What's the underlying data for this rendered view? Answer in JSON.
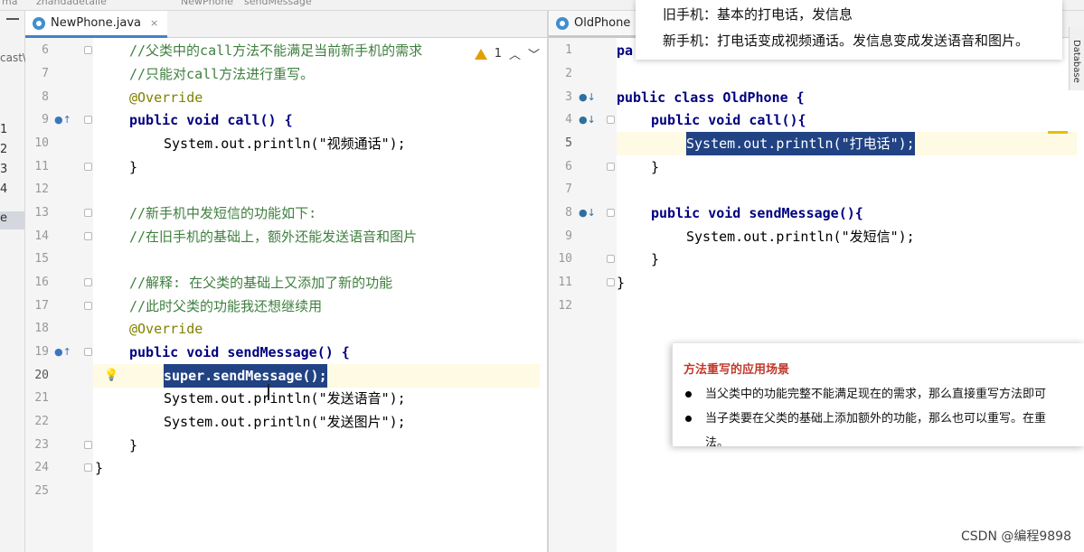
{
  "breadcrumb": {
    "part1": "ma",
    "part2": "zhandadetaile",
    "part3": "NewPhone",
    "part4": "sendMessage"
  },
  "project": {
    "cast_label": "cast\\",
    "numbers": [
      "1",
      "2",
      "3",
      "4"
    ],
    "selected": "e"
  },
  "left_editor": {
    "tab_label": "NewPhone.java",
    "tab_close": "×",
    "warning_count": "1",
    "lines": [
      {
        "n": "6",
        "text": "//父类中的call方法不能满足当前新手机的需求"
      },
      {
        "n": "7",
        "text": "//只能对call方法进行重写。"
      },
      {
        "n": "8",
        "text": "@Override"
      },
      {
        "n": "9",
        "text": "public void call() {"
      },
      {
        "n": "10",
        "text": "System.out.println(\"视频通话\");"
      },
      {
        "n": "11",
        "text": "}"
      },
      {
        "n": "12",
        "text": ""
      },
      {
        "n": "13",
        "text": "//新手机中发短信的功能如下:"
      },
      {
        "n": "14",
        "text": "//在旧手机的基础上，额外还能发送语音和图片"
      },
      {
        "n": "15",
        "text": ""
      },
      {
        "n": "16",
        "text": "//解释: 在父类的基础上又添加了新的功能"
      },
      {
        "n": "17",
        "text": "//此时父类的功能我还想继续用"
      },
      {
        "n": "18",
        "text": "@Override"
      },
      {
        "n": "19",
        "text": "public void sendMessage() {"
      },
      {
        "n": "20",
        "text": "super.sendMessage();"
      },
      {
        "n": "21",
        "text": "System.out.println(\"发送语音\");"
      },
      {
        "n": "22",
        "text": "System.out.println(\"发送图片\");"
      },
      {
        "n": "23",
        "text": "}"
      },
      {
        "n": "24",
        "text": "}"
      },
      {
        "n": "25",
        "text": ""
      }
    ]
  },
  "right_editor": {
    "tab_label": "OldPhone",
    "lines": [
      {
        "n": "1",
        "text": "pa"
      },
      {
        "n": "2",
        "text": ""
      },
      {
        "n": "3",
        "text": "public class OldPhone {"
      },
      {
        "n": "4",
        "text": "public void call(){"
      },
      {
        "n": "5",
        "text": "System.out.println(\"打电话\");"
      },
      {
        "n": "6",
        "text": "}"
      },
      {
        "n": "7",
        "text": ""
      },
      {
        "n": "8",
        "text": "public void sendMessage(){"
      },
      {
        "n": "9",
        "text": "System.out.println(\"发短信\");"
      },
      {
        "n": "10",
        "text": "}"
      },
      {
        "n": "11",
        "text": "}"
      },
      {
        "n": "12",
        "text": ""
      }
    ]
  },
  "side_tab": {
    "label": "Database"
  },
  "note_top": {
    "line1": "旧手机：基本的打电话，发信息",
    "line2": "新手机：打电话变成视频通话。发信息变成发送语音和图片。"
  },
  "note_bottom": {
    "title": "方法重写的应用场景",
    "item1": "当父类中的功能完整不能满足现在的需求，那么直接重写方法即可",
    "item2": "当子类要在父类的基础上添加额外的功能，那么也可以重写。在重",
    "item2_cont": "法。"
  },
  "watermark": "CSDN @编程9898",
  "colors": {
    "keyword": "#000080",
    "comment": "#3f7f3f",
    "string": "#067d17",
    "annotation": "#808000",
    "selection": "#214283",
    "tab_accent": "#4083c9",
    "note_title": "#c0392b"
  }
}
